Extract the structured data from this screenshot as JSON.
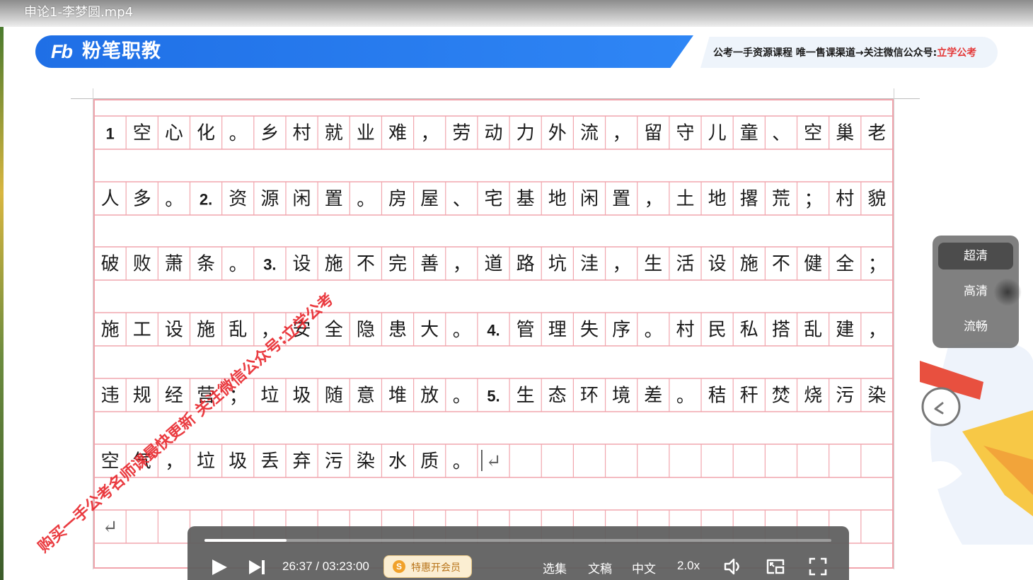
{
  "window": {
    "title": "申论1-李梦圆.mp4"
  },
  "banner": {
    "logo_mark": "Fb",
    "logo_text": "粉笔职教",
    "slogan_main": "公考一手资源课程 唯一售课渠道→关注微信公众号:",
    "slogan_highlight": "立学公考"
  },
  "grid": {
    "rows": [
      [
        "1",
        "空",
        "心",
        "化",
        "。",
        "乡",
        "村",
        "就",
        "业",
        "难",
        "，",
        "劳",
        "动",
        "力",
        "外",
        "流",
        "，",
        "留",
        "守",
        "儿",
        "童",
        "、",
        "空",
        "巢",
        "老"
      ],
      [
        "人",
        "多",
        "。",
        "2.",
        "资",
        "源",
        "闲",
        "置",
        "。",
        "房",
        "屋",
        "、",
        "宅",
        "基",
        "地",
        "闲",
        "置",
        "，",
        "土",
        "地",
        "撂",
        "荒",
        "；",
        "村",
        "貌"
      ],
      [
        "破",
        "败",
        "萧",
        "条",
        "。",
        "3.",
        "设",
        "施",
        "不",
        "完",
        "善",
        "，",
        "道",
        "路",
        "坑",
        "洼",
        "，",
        "生",
        "活",
        "设",
        "施",
        "不",
        "健",
        "全",
        "；"
      ],
      [
        "施",
        "工",
        "设",
        "施",
        "乱",
        "，",
        "安",
        "全",
        "隐",
        "患",
        "大",
        "。",
        "4.",
        "管",
        "理",
        "失",
        "序",
        "。",
        "村",
        "民",
        "私",
        "搭",
        "乱",
        "建",
        "，"
      ],
      [
        "违",
        "规",
        "经",
        "营",
        "；",
        "垃",
        "圾",
        "随",
        "意",
        "堆",
        "放",
        "。",
        "5.",
        "生",
        "态",
        "环",
        "境",
        "差",
        "。",
        "秸",
        "秆",
        "焚",
        "烧",
        "污",
        "染"
      ],
      [
        "空",
        "气",
        "，",
        "垃",
        "圾",
        "丢",
        "弃",
        "污",
        "染",
        "水",
        "质",
        "。",
        "↵",
        "",
        "",
        "",
        "",
        "",
        "",
        "",
        "",
        "",
        "",
        "",
        ""
      ],
      [
        "↵",
        "",
        "",
        "",
        "",
        "",
        "",
        "",
        "",
        "",
        "",
        "",
        "",
        "",
        "",
        "",
        "",
        "",
        "",
        "",
        "",
        "",
        "",
        "",
        ""
      ]
    ]
  },
  "watermark": {
    "text": "购买一手公考名师课最快更新 关注微信公众号:立学公考"
  },
  "quality_menu": {
    "items": [
      "超清",
      "高清",
      "流畅"
    ],
    "selected": "超清"
  },
  "player": {
    "time": "26:37 / 03:23:00",
    "progress": 0.131,
    "vip_icon": "S",
    "vip_label": "特惠开会员",
    "episodes_label": "选集",
    "transcript_label": "文稿",
    "subtitle_label": "中文",
    "speed_label": "2.0x",
    "icons": [
      "play-icon",
      "next-icon",
      "volume-icon",
      "picture-in-picture-icon",
      "fullscreen-icon"
    ],
    "colors": {
      "accent": "#ffffff",
      "vip": "#b8741a"
    }
  },
  "colors": {
    "banner": "#2f86f5",
    "grid_line": "#f1a5ad",
    "watermark": "#e8262c"
  }
}
